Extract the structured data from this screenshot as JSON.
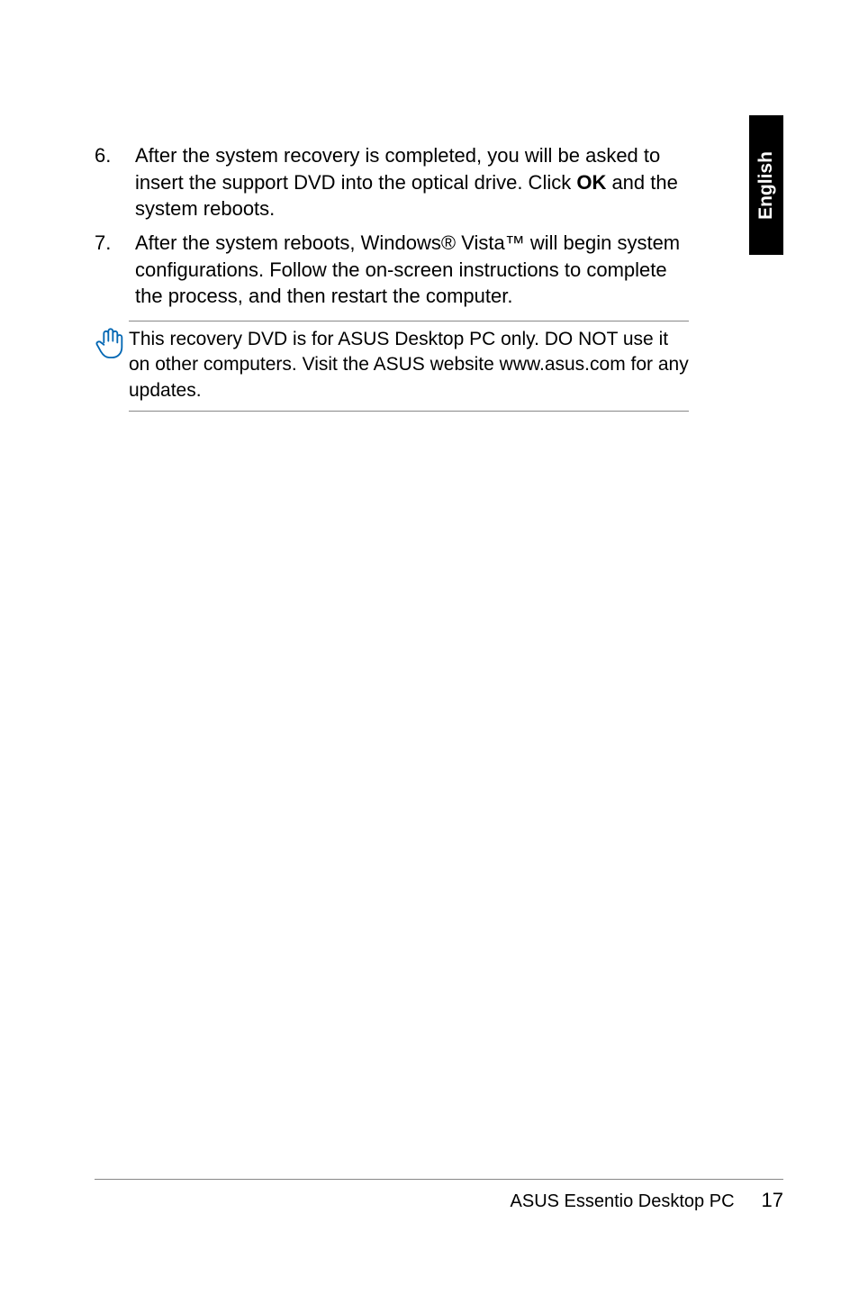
{
  "sideTab": "English",
  "list": [
    {
      "num": "6.",
      "parts": [
        {
          "t": "After the system recovery is completed, you will be asked to insert the support DVD into the optical drive. Click ",
          "b": false
        },
        {
          "t": "OK",
          "b": true
        },
        {
          "t": " and the system reboots.",
          "b": false
        }
      ]
    },
    {
      "num": "7.",
      "parts": [
        {
          "t": "After the system reboots, Windows® Vista™ will begin system configurations. Follow the on-screen instructions to complete the process, and then restart the computer.",
          "b": false
        }
      ]
    }
  ],
  "note": "This recovery DVD is for ASUS Desktop PC only. DO NOT use it on other computers. Visit the ASUS website www.asus.com for any updates.",
  "footer": {
    "title": "ASUS Essentio Desktop PC",
    "page": "17"
  }
}
